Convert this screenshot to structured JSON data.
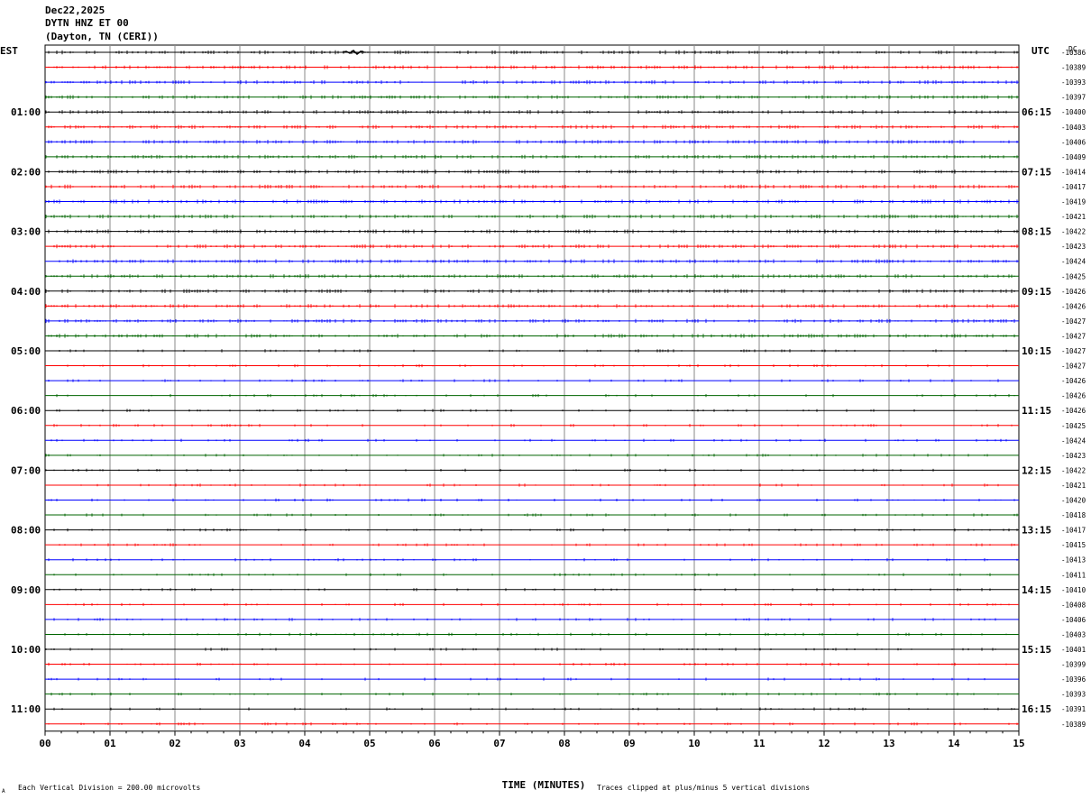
{
  "header": {
    "date": "Dec22,2025",
    "station": "DYTN HNZ ET 00",
    "location": "(Dayton, TN (CERI))"
  },
  "footer": {
    "scale_note": "Each Vertical Division =  200.00 microvolts",
    "clip_note": "Traces clipped at plus/minus 5 vertical divisions",
    "corner_mark": "A"
  },
  "chart_data": {
    "type": "line",
    "title": "",
    "xlabel": "TIME (MINUTES)",
    "ylabel": "",
    "left_axis_title": "EST",
    "right_axis_title": "UTC",
    "dc_header": "DC",
    "xlim": [
      0,
      15
    ],
    "x_ticks": [
      "00",
      "01",
      "02",
      "03",
      "04",
      "05",
      "06",
      "07",
      "08",
      "09",
      "10",
      "11",
      "12",
      "13",
      "14",
      "15"
    ],
    "grid": true,
    "left_hour_labels": [
      "01:00",
      "02:00",
      "03:00",
      "04:00",
      "05:00",
      "06:00",
      "07:00",
      "08:00",
      "09:00",
      "10:00",
      "11:00"
    ],
    "right_hour_labels": [
      "06:15",
      "07:15",
      "08:15",
      "09:15",
      "10:15",
      "11:15",
      "12:15",
      "13:15",
      "14:15",
      "15:15",
      "16:15"
    ],
    "dc_offsets": [
      "-10386",
      "-10389",
      "-10393",
      "-10397",
      "-10400",
      "-10403",
      "-10406",
      "-10409",
      "-10414",
      "-10417",
      "-10419",
      "-10421",
      "-10422",
      "-10423",
      "-10424",
      "-10425",
      "-10426",
      "-10426",
      "-10427",
      "-10427",
      "-10427",
      "-10427",
      "-10426",
      "-10426",
      "-10426",
      "-10425",
      "-10424",
      "-10423",
      "-10422",
      "-10421",
      "-10420",
      "-10418",
      "-10417",
      "-10415",
      "-10413",
      "-10411",
      "-10410",
      "-10408",
      "-10406",
      "-10403",
      "-10401",
      "-10399",
      "-10396",
      "-10393",
      "-10391",
      "-10389"
    ],
    "trace_colors": [
      "#000000",
      "#ff0000",
      "#0000ff",
      "#006400"
    ],
    "series": [
      {
        "color": "#000000",
        "count": 12
      },
      {
        "color": "#ff0000",
        "count": 12
      },
      {
        "color": "#0000ff",
        "count": 11
      },
      {
        "color": "#006400",
        "count": 11
      }
    ],
    "trace_count": 46
  }
}
